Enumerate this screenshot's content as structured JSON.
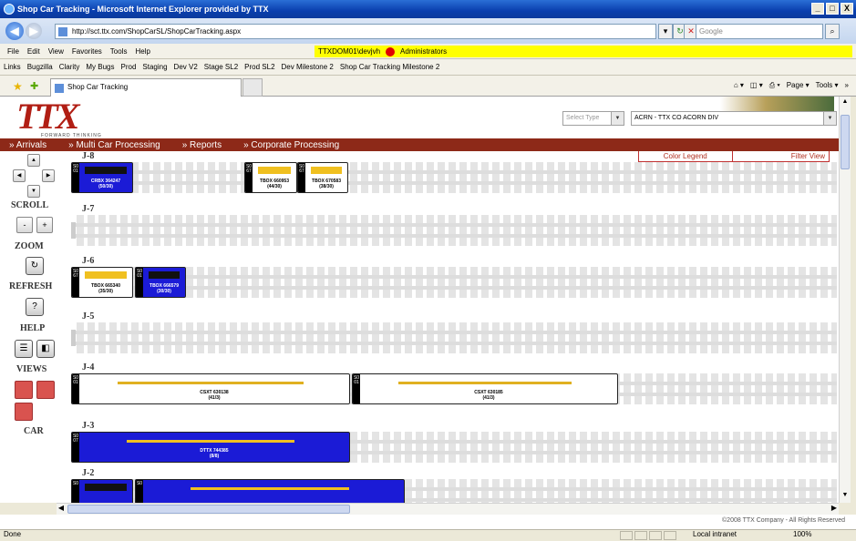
{
  "window": {
    "title": "Shop Car Tracking - Microsoft Internet Explorer provided by TTX",
    "buttons": [
      "_",
      "□",
      "X"
    ]
  },
  "address": {
    "url": "http://sct.ttx.com/ShopCarSL/ShopCarTracking.aspx",
    "search_placeholder": "Google"
  },
  "menu": [
    "File",
    "Edit",
    "View",
    "Favorites",
    "Tools",
    "Help"
  ],
  "user": {
    "login": "TTXDOM01\\devjvh",
    "role": "Administrators"
  },
  "links": [
    "Links",
    "Bugzilla",
    "Clarity",
    "My Bugs",
    "Prod",
    "Staging",
    "Dev V2",
    "Stage SL2",
    "Prod SL2",
    "Dev Milestone 2",
    "Shop Car Tracking Milestone 2"
  ],
  "tab": {
    "title": "Shop Car Tracking"
  },
  "commands": [
    "Page ▾",
    "Tools ▾",
    "»"
  ],
  "app": {
    "logo": "TTX",
    "tagline": "FORWARD THINKING",
    "type_select": "Select Type",
    "division_select": "ACRN - TTX CO ACORN DIV",
    "nav": [
      "» Arrivals",
      "» Multi Car Processing",
      "» Reports",
      "» Corporate Processing"
    ],
    "subnav": [
      "Color Legend",
      "Filter View"
    ]
  },
  "sidebar": {
    "scroll": "SCROLL",
    "zoom": "ZOOM",
    "refresh": "REFRESH",
    "help": "HELP",
    "views": "VIEWS",
    "car": "CAR",
    "help_icon": "?",
    "zoom_minus": "-",
    "zoom_plus": "+"
  },
  "tracks": [
    {
      "label": "J-8",
      "cars": [
        {
          "name": "CRBX 364247",
          "sub": "(50/30)",
          "tag": "S001",
          "color": "blue"
        },
        {
          "name": "TBOX 660953",
          "sub": "(44/30)",
          "tag": "S067",
          "color": "yellow"
        },
        {
          "name": "TBOX 670583",
          "sub": "(38/30)",
          "tag": "S067",
          "color": "yellow"
        }
      ]
    },
    {
      "label": "J-7",
      "cars": []
    },
    {
      "label": "J-6",
      "cars": [
        {
          "name": "TBOX 665340",
          "sub": "(35/30)",
          "tag": "S067",
          "color": "yellow"
        },
        {
          "name": "TBOX 666579",
          "sub": "(30/30)",
          "tag": "S001",
          "color": "blue"
        }
      ]
    },
    {
      "label": "J-5",
      "cars": []
    },
    {
      "label": "J-4",
      "cars": [
        {
          "name": "CSXT 630138",
          "sub": "(41/3)",
          "tag": "S001",
          "color": "white"
        },
        {
          "name": "CSXT 630185",
          "sub": "(41/3)",
          "tag": "S001",
          "color": "white"
        }
      ]
    },
    {
      "label": "J-3",
      "cars": [
        {
          "name": "DTTX 744385",
          "sub": "(8/8)",
          "tag": "S007",
          "color": "blue"
        }
      ]
    },
    {
      "label": "J-2",
      "cars": [
        {
          "name": "",
          "sub": "",
          "tag": "S0",
          "color": "blue"
        },
        {
          "name": "",
          "sub": "",
          "tag": "S0",
          "color": "blue"
        }
      ]
    }
  ],
  "footer": {
    "copyright": "©2008 TTX Company - All Rights Reserved"
  },
  "status": {
    "text": "Done",
    "zone": "Local intranet",
    "zoom": "100%"
  },
  "colors": {
    "brand_red": "#b11e14",
    "nav_bar": "#8d2918",
    "car_blue": "#1b1bd6",
    "car_yellow": "#f0c020"
  }
}
